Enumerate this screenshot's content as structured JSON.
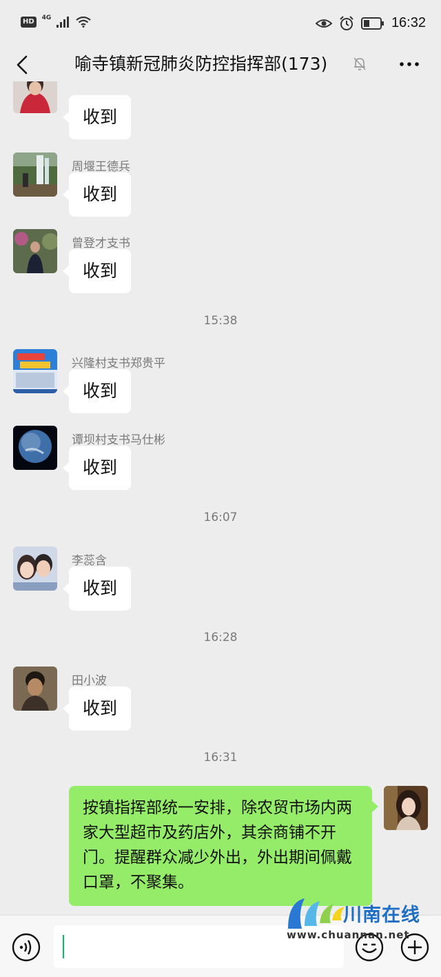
{
  "status_bar": {
    "hd_badge": "HD",
    "network": "4G",
    "time": "16:32"
  },
  "header": {
    "title": "喻寺镇新冠肺炎防控指挥部(173)"
  },
  "messages": [
    {
      "sender": "",
      "text": "收到",
      "avatar": "avatar-red-jacket"
    },
    {
      "sender": "周堰王德兵",
      "text": "收到",
      "avatar": "avatar-waterfall"
    },
    {
      "sender": "曾登才支书",
      "text": "收到",
      "avatar": "avatar-man-suit"
    },
    {
      "sender": "兴隆村支书郑贵平",
      "text": "收到",
      "avatar": "avatar-poster"
    },
    {
      "sender": "谭坝村支书马仕彬",
      "text": "收到",
      "avatar": "avatar-earth"
    },
    {
      "sender": "李蕊含",
      "text": "收到",
      "avatar": "avatar-cartoon-couple"
    },
    {
      "sender": "田小波",
      "text": "收到",
      "avatar": "avatar-man-portrait"
    }
  ],
  "timestamps": [
    "15:38",
    "16:07",
    "16:28",
    "16:31"
  ],
  "outgoing": {
    "text": "按镇指挥部统一安排，除农贸市场内两家大型超市及药店外，其余商铺不开门。提醒群众减少外出，外出期间佩戴口罩，不聚集。",
    "avatar": "avatar-woman-portrait"
  },
  "input": {
    "value": ""
  },
  "watermark": {
    "name": "川南在线",
    "url": "www.chuannan.net"
  },
  "colors": {
    "background": "#ededed",
    "outgoing_bubble": "#95ec69",
    "incoming_bubble": "#ffffff",
    "accent": "#07c160"
  }
}
